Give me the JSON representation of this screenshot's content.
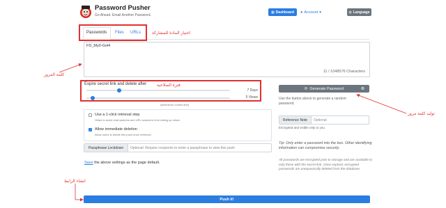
{
  "header": {
    "brand_title": "Password Pusher",
    "brand_subtitle": "Go Ahead. Email Another Password.",
    "dashboard_label": "Dashboard",
    "account_label": "Account",
    "language_label": "Language"
  },
  "tabs": [
    {
      "label": "Passwords",
      "active": true
    },
    {
      "label": "Files",
      "active": false
    },
    {
      "label": "URLs",
      "active": false
    }
  ],
  "annotations": {
    "tabs": "اختيار المادة للمشاركة",
    "password": "كلمة المرور",
    "expire": "فترة الصلاحية",
    "generate": "توليد كلمة مرور",
    "push": "انشاء الرابط"
  },
  "password_field": {
    "value": "FD_My0-Gol4",
    "char_count": "11 / 1048576 Characters"
  },
  "expiration": {
    "label": "Expire secret link and delete after:",
    "days_label": "7 Days",
    "days_value": 7,
    "views_label": "5 Views",
    "views_value": 5,
    "whichever": "(whichever comes first)"
  },
  "options": {
    "one_click_title": "Use a 1-click retrieval step",
    "one_click_help": "Helps to avoid chat systems and URL scanners from eating up views.",
    "one_click_checked": false,
    "delete_title": "Allow immediate deletion",
    "delete_help": "Allow users to delete this push once retrieved.",
    "delete_checked": true
  },
  "passphrase": {
    "label": "Passphrase Lockdown",
    "placeholder": "Optional: Require recipients to enter a passphrase to view this push"
  },
  "save_settings": {
    "link": "Save",
    "rest": " the above settings as the page default."
  },
  "generator": {
    "button_label": "Generate Password",
    "help": "Use the button above to generate a random password."
  },
  "reference": {
    "label": "Reference Note",
    "placeholder": "Optional",
    "help": "Encrypted and visible only to you."
  },
  "tip": "Tip: Only enter a password into the box. Other identifying information can compromise security.",
  "info": "All passwords are encrypted prior to storage and are available to only those with the secret link. Once expired, encrypted passwords are unequivocally deleted from the database.",
  "push_button": "Push it!",
  "colors": {
    "accent": "#2a7de1",
    "annotation": "#e03030",
    "secondary": "#6c757d"
  }
}
